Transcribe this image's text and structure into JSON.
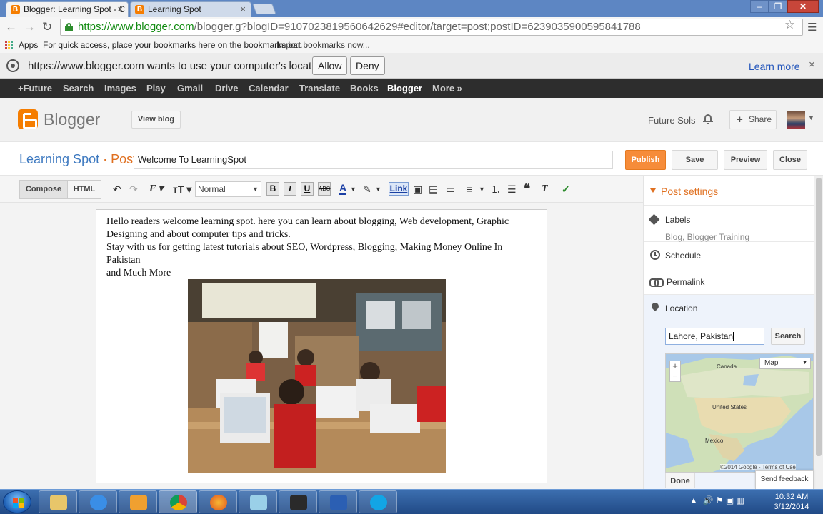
{
  "browser": {
    "tabs": [
      {
        "title": "Blogger: Learning Spot - C"
      },
      {
        "title": "Learning Spot"
      }
    ],
    "url_host": "https://www.blogger.com",
    "url_path": "/blogger.g?blogID=9107023819560642629#editor/target=post;postID=6239035900595841788",
    "bookmarks_apps": "Apps",
    "bookmarks_hint": "For quick access, place your bookmarks here on the bookmarks bar.",
    "bookmarks_import": "Import bookmarks now...",
    "infobar": {
      "message": "https://www.blogger.com wants to use your computer's location.",
      "allow": "Allow",
      "deny": "Deny",
      "learn_more": "Learn more"
    }
  },
  "gbar": {
    "items": [
      "+Future",
      "Search",
      "Images",
      "Play",
      "Gmail",
      "Drive",
      "Calendar",
      "Translate",
      "Books",
      "Blogger",
      "More »"
    ]
  },
  "blogger": {
    "brand": "Blogger",
    "view_blog": "View blog",
    "user_name": "Future Sols",
    "share": "Share",
    "blog_title": "Learning Spot",
    "crumb_sep": " · ",
    "crumb_post": "Post",
    "post_title": "Welcome To LearningSpot",
    "publish": "Publish",
    "save": "Save",
    "preview": "Preview",
    "close": "Close"
  },
  "editor": {
    "compose": "Compose",
    "html": "HTML",
    "format": "Normal",
    "bold": "B",
    "italic": "I",
    "underline": "U",
    "strike": "ABC",
    "link": "Link",
    "para1_line1": "Hello readers welcome learning spot. here you can learn about blogging, Web development, Graphic",
    "para1_line2": "Designing and about computer tips and tricks.",
    "para2_line1": "Stay with us for getting latest tutorials about SEO, Wordpress, Blogging, Making Money Online In Pakistan",
    "para2_line2": "and Much More"
  },
  "settings": {
    "title": "Post settings",
    "labels": "Labels",
    "labels_value": "Blog, Blogger Training",
    "schedule": "Schedule",
    "permalink": "Permalink",
    "location": "Location",
    "location_value": "Lahore, Pakistan",
    "search": "Search",
    "map_type": "Map",
    "map_canada": "Canada",
    "map_us": "United States",
    "map_mexico": "Mexico",
    "map_copyright": "©2014 Google -",
    "map_terms": "Terms of Use",
    "done": "Done",
    "send_feedback": "Send feedback"
  },
  "taskbar": {
    "time": "10:32 AM",
    "date": "3/12/2014"
  },
  "colors": {
    "blogger_orange": "#f57d00",
    "publish_orange": "#f68c3a",
    "link_blue": "#3d79c0"
  }
}
